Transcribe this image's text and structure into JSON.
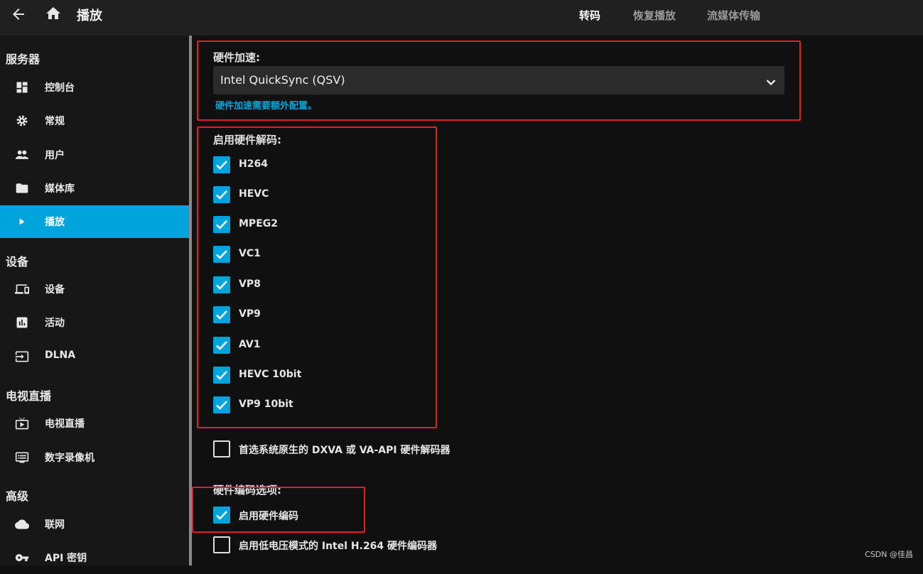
{
  "header": {
    "title": "播放",
    "tabs": [
      {
        "label": "转码",
        "active": true
      },
      {
        "label": "恢复播放",
        "active": false
      },
      {
        "label": "流媒体传输",
        "active": false
      }
    ]
  },
  "sidebar": {
    "sections": [
      "服务器",
      "设备",
      "电视直播",
      "高级"
    ],
    "items": [
      {
        "label": "控制台",
        "icon": "dashboard-icon"
      },
      {
        "label": "常规",
        "icon": "gear-icon"
      },
      {
        "label": "用户",
        "icon": "people-icon"
      },
      {
        "label": "媒体库",
        "icon": "folder-icon"
      },
      {
        "label": "播放",
        "icon": "play-icon",
        "active": true
      },
      {
        "label": "设备",
        "icon": "devices-icon"
      },
      {
        "label": "活动",
        "icon": "activity-icon"
      },
      {
        "label": "DLNA",
        "icon": "input-icon"
      },
      {
        "label": "电视直播",
        "icon": "live-tv-icon"
      },
      {
        "label": "数字录像机",
        "icon": "dvr-icon"
      },
      {
        "label": "联网",
        "icon": "cloud-icon"
      },
      {
        "label": "API 密钥",
        "icon": "key-icon"
      }
    ]
  },
  "main": {
    "hw_accel_label": "硬件加速:",
    "hw_accel_value": "Intel QuickSync (QSV)",
    "hw_accel_help": "硬件加速需要额外配置。",
    "decoding_label": "启用硬件解码:",
    "codecs": [
      {
        "label": "H264",
        "checked": true
      },
      {
        "label": "HEVC",
        "checked": true
      },
      {
        "label": "MPEG2",
        "checked": true
      },
      {
        "label": "VC1",
        "checked": true
      },
      {
        "label": "VP8",
        "checked": true
      },
      {
        "label": "VP9",
        "checked": true
      },
      {
        "label": "AV1",
        "checked": true
      },
      {
        "label": "HEVC 10bit",
        "checked": true
      },
      {
        "label": "VP9 10bit",
        "checked": true
      }
    ],
    "prefer_native": {
      "label": "首选系统原生的 DXVA 或 VA-API 硬件解码器",
      "checked": false
    },
    "encoding_label": "硬件编码选项:",
    "enable_hw_encoding": {
      "label": "启用硬件编码",
      "checked": true
    },
    "low_power": {
      "label": "启用低电压模式的 Intel H.264 硬件编码器",
      "checked": false
    }
  },
  "colors": {
    "accent": "#00a4dc",
    "highlight": "#e3201f",
    "background": "#101010"
  },
  "watermark": "CSDN @佳昌"
}
